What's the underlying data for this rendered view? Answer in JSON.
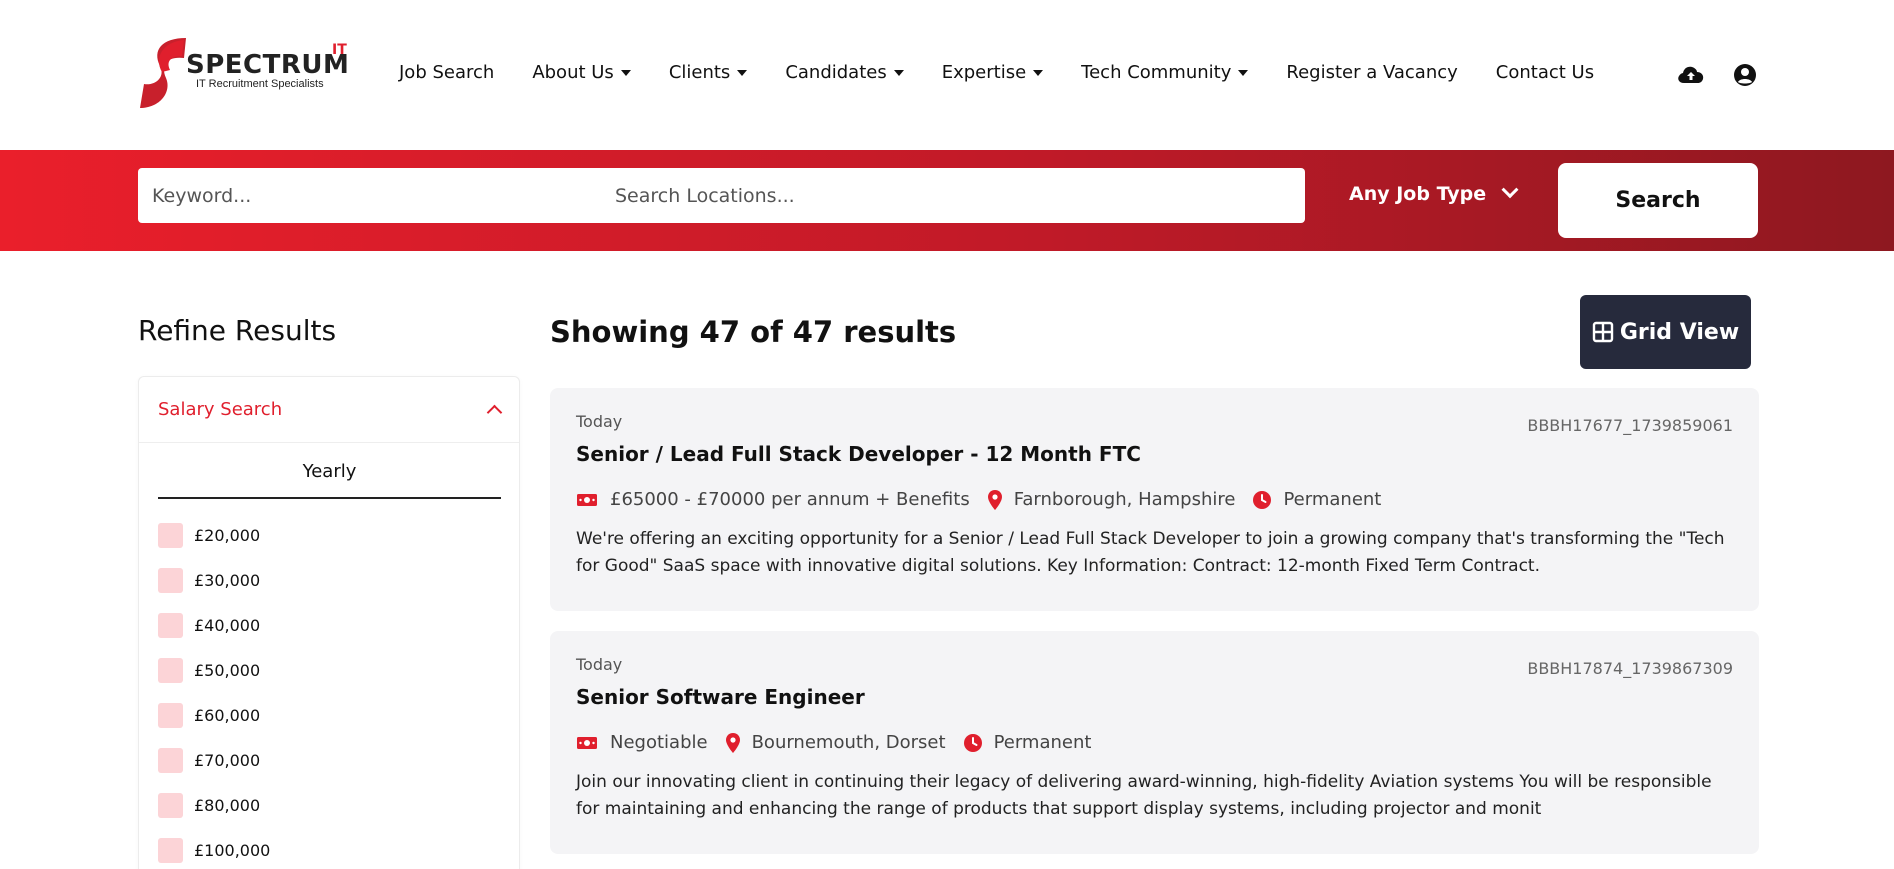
{
  "brand": {
    "name": "SPECTRUM",
    "superscript": "IT",
    "tagline": "IT Recruitment Specialists",
    "accent": "#e01f2d",
    "dark": "#262a3c"
  },
  "nav": {
    "items": [
      {
        "label": "Job Search",
        "dropdown": false
      },
      {
        "label": "About Us",
        "dropdown": true
      },
      {
        "label": "Clients",
        "dropdown": true
      },
      {
        "label": "Candidates",
        "dropdown": true
      },
      {
        "label": "Expertise",
        "dropdown": true
      },
      {
        "label": "Tech Community",
        "dropdown": true
      },
      {
        "label": "Register a Vacancy",
        "dropdown": false
      },
      {
        "label": "Contact Us",
        "dropdown": false
      }
    ],
    "icons": [
      "upload-cloud-icon",
      "user-account-icon"
    ]
  },
  "search": {
    "keyword_placeholder": "Keyword...",
    "location_placeholder": "Search Locations...",
    "job_type": "Any Job Type",
    "button": "Search"
  },
  "sidebar": {
    "title": "Refine Results",
    "filter_title": "Salary Search",
    "tab": "Yearly",
    "salaries": [
      "£20,000",
      "£30,000",
      "£40,000",
      "£50,000",
      "£60,000",
      "£70,000",
      "£80,000",
      "£100,000"
    ]
  },
  "results": {
    "count_text": "Showing 47 of 47 results",
    "view_button": "Grid View",
    "jobs": [
      {
        "date": "Today",
        "ref": "BBBH17677_1739859061",
        "title": "Senior / Lead Full Stack Developer - 12 Month FTC",
        "salary": "£65000 - £70000 per annum + Benefits",
        "location": "Farnborough, Hampshire",
        "type": "Permanent",
        "description": "We're offering an exciting opportunity for a Senior / Lead Full Stack Developer to join a growing company that's transforming the \"Tech for Good\" SaaS space with innovative digital solutions. Key Information: Contract: 12-month Fixed Term Contract."
      },
      {
        "date": "Today",
        "ref": "BBBH17874_1739867309",
        "title": "Senior Software Engineer",
        "salary": "Negotiable",
        "location": "Bournemouth, Dorset",
        "type": "Permanent",
        "description": "Join our innovating client in continuing their legacy of delivering award-winning, high-fidelity Aviation systems You will be responsible for maintaining and enhancing the range of products that support display systems, including projector and monit"
      }
    ]
  }
}
